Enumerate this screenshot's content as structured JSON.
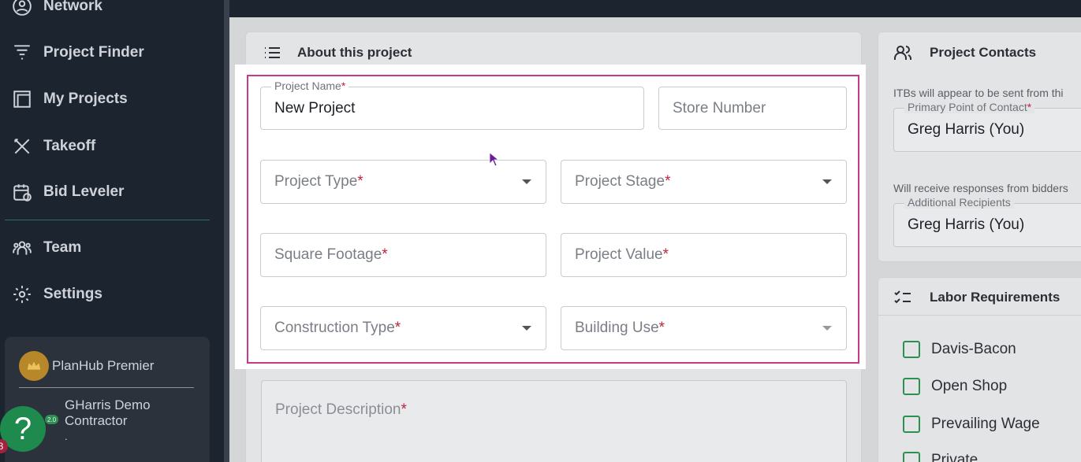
{
  "sidebar": {
    "items": [
      {
        "label": "Network",
        "icon": "network-icon"
      },
      {
        "label": "Project Finder",
        "icon": "filter-icon"
      },
      {
        "label": "My Projects",
        "icon": "projects-icon"
      },
      {
        "label": "Takeoff",
        "icon": "takeoff-icon"
      },
      {
        "label": "Bid Leveler",
        "icon": "calendar-icon"
      },
      {
        "label": "Team",
        "icon": "team-icon"
      },
      {
        "label": "Settings",
        "icon": "gear-icon"
      }
    ],
    "premier_label": "PlanHub Premier",
    "user_name": "GHarris Demo Contractor",
    "user_sub": ".",
    "help_label": "?",
    "help_badge": "3",
    "mini_badge": "2.0"
  },
  "about": {
    "title": "About this project",
    "project_name_label": "Project Name",
    "project_name_value": "New Project",
    "store_number_placeholder": "Store Number",
    "project_type_label": "Project Type",
    "project_stage_label": "Project Stage",
    "square_footage_label": "Square Footage",
    "project_value_label": "Project Value",
    "construction_type_label": "Construction Type",
    "building_use_label": "Building Use",
    "project_description_label": "Project Description",
    "required_mark": "*"
  },
  "contacts": {
    "title": "Project Contacts",
    "itb_note": "ITBs will appear to be sent from thi",
    "primary_label": "Primary Point of Contact",
    "primary_value": "Greg Harris (You)",
    "responses_note": "Will receive responses from bidders",
    "additional_label": "Additional Recipients",
    "additional_value": "Greg Harris (You)"
  },
  "labor": {
    "title": "Labor Requirements",
    "options": [
      "Davis-Bacon",
      "Open Shop",
      "Prevailing Wage",
      "Private"
    ]
  },
  "colors": {
    "sidebar_bg": "#1c2430",
    "accent_pink": "#c53a8a",
    "required_red": "#c0213f",
    "checkbox_green": "#2d8f53"
  }
}
